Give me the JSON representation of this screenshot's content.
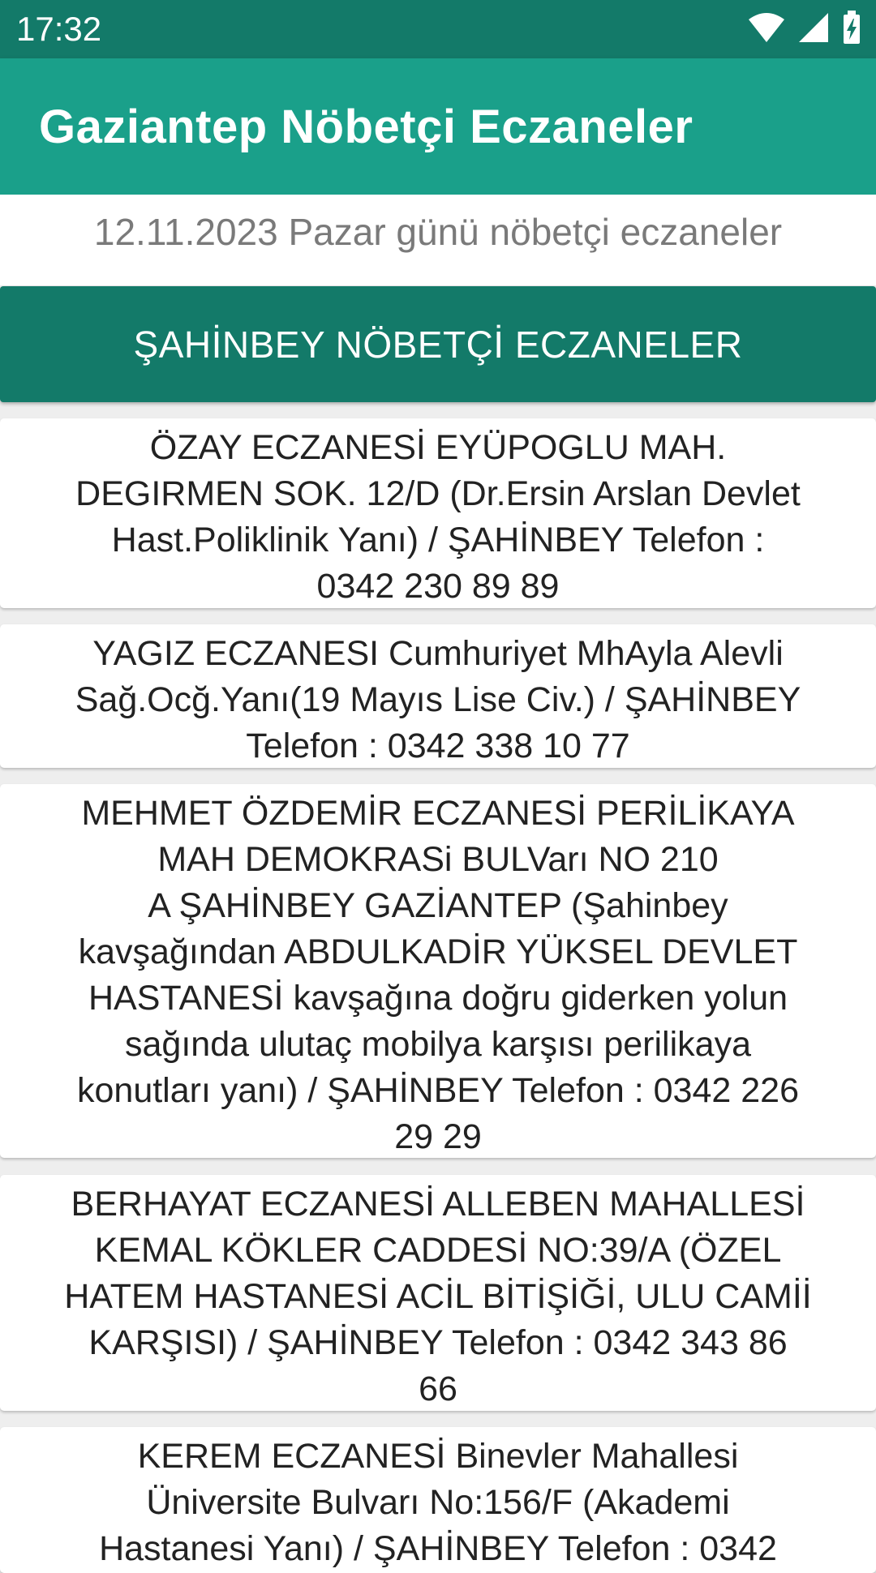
{
  "status_bar": {
    "time": "17:32",
    "icons": [
      "wifi-icon",
      "cell-signal-icon",
      "battery-charging-icon"
    ]
  },
  "app_bar": {
    "title": "Gaziantep Nöbetçi Eczaneler"
  },
  "date_header": "12.11.2023 Pazar günü nöbetçi eczaneler",
  "district_button": {
    "label": "ŞAHİNBEY NÖBETÇİ ECZANELER"
  },
  "pharmacies": [
    {
      "text": "ÖZAY ECZANESİ EYÜPOGLU MAH.\nDEGIRMEN SOK. 12/D (Dr.Ersin Arslan Devlet\nHast.Poliklinik Yanı) / ŞAHİNBEY Telefon :\n0342 230 89 89"
    },
    {
      "text": "YAGIZ ECZANESI Cumhuriyet MhAyla Alevli\nSağ.Ocğ.Yanı(19 Mayıs Lise Civ.) / ŞAHİNBEY\nTelefon : 0342 338 10 77"
    },
    {
      "text": "MEHMET ÖZDEMİR ECZANESİ PERİLİKAYA\nMAH DEMOKRASi BULVarı NO 210\nA ŞAHİNBEY GAZİANTEP (Şahinbey\nkavşağından ABDULKADİR YÜKSEL DEVLET\nHASTANESİ kavşağına doğru giderken yolun\nsağında ulutaç mobilya karşısı perilikaya\nkonutları yanı) / ŞAHİNBEY Telefon : 0342 226\n29 29"
    },
    {
      "text": "BERHAYAT ECZANESİ ALLEBEN MAHALLESİ\nKEMAL KÖKLER CADDESİ NO:39/A (ÖZEL\nHATEM HASTANESİ ACİL BİTİŞİĞİ, ULU CAMİİ\nKARŞISI) / ŞAHİNBEY Telefon : 0342 343 86\n66"
    },
    {
      "text": "KEREM ECZANESİ Binevler Mahallesi\nÜniversite Bulvarı No:156/F (Akademi\nHastanesi Yanı) / ŞAHİNBEY Telefon : 0342"
    }
  ],
  "colors": {
    "status_bar": "#137a69",
    "app_bar": "#1aa08a",
    "district_button": "#137a69",
    "list_background": "#eeeeee",
    "card_background": "#ffffff",
    "date_text": "#7a7a7a"
  }
}
